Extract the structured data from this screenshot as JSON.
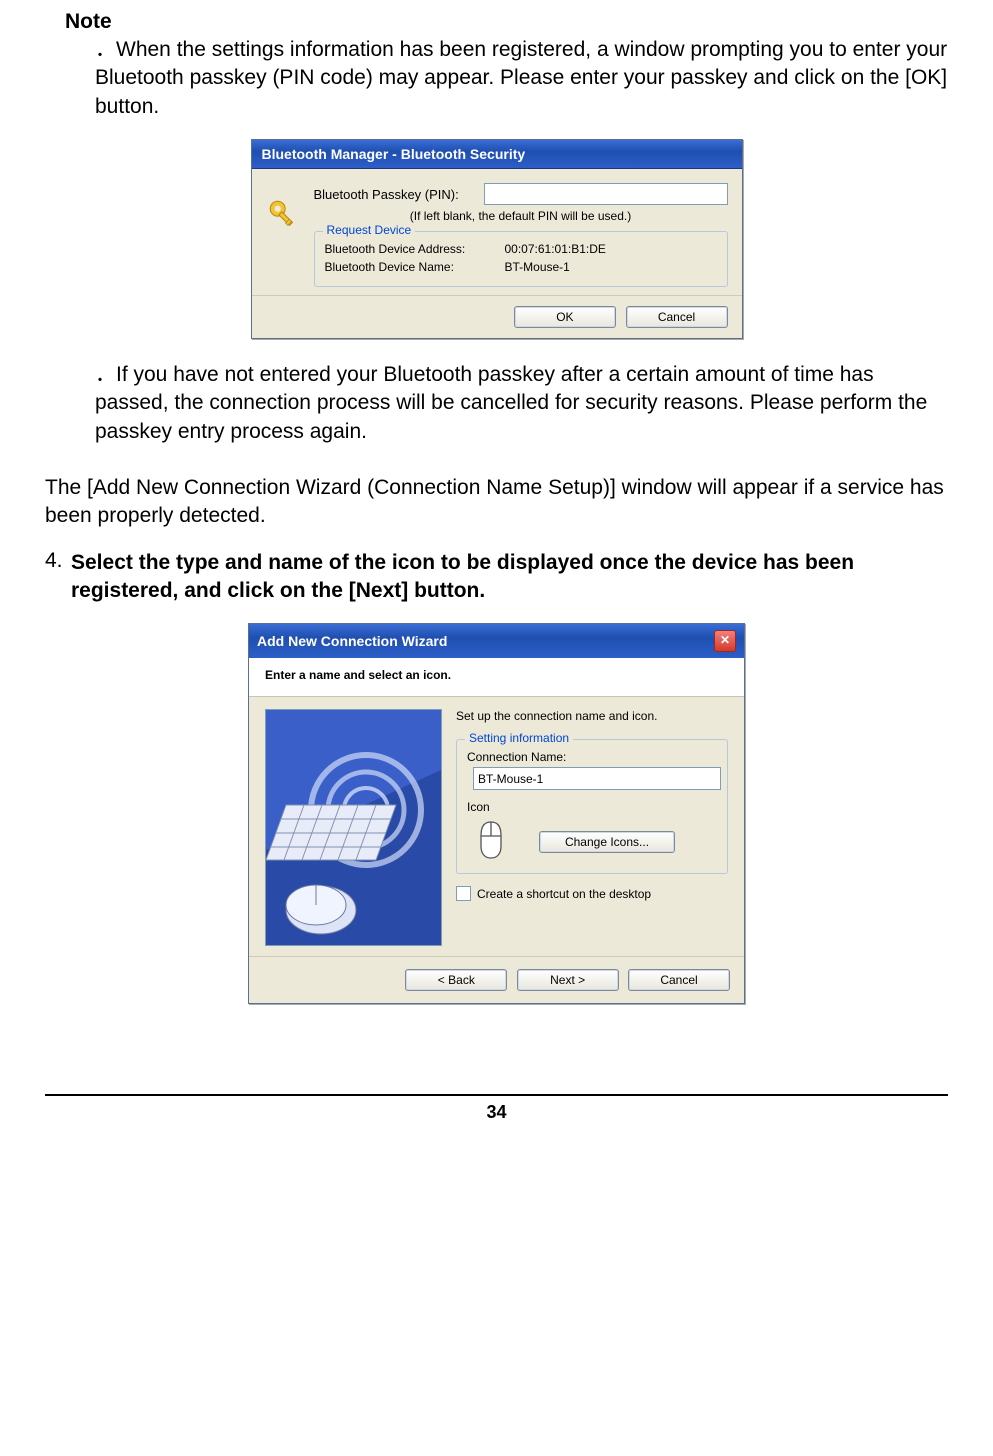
{
  "note": {
    "heading": "Note",
    "item1": "．When the settings information has been registered, a window prompting you to enter your Bluetooth passkey (PIN code) may appear. Please enter your passkey and click on the [OK] button.",
    "item2": "．If you have not entered your Bluetooth passkey after a certain amount of time has passed, the connection process will be cancelled for security reasons. Please perform the passkey entry process again."
  },
  "dialog1": {
    "title": "Bluetooth Manager - Bluetooth Security",
    "passkey_label": "Bluetooth Passkey (PIN):",
    "hint": "(If left blank, the default PIN will be used.)",
    "group_legend": "Request Device",
    "addr_label": "Bluetooth Device Address:",
    "addr_value": "00:07:61:01:B1:DE",
    "name_label": "Bluetooth Device Name:",
    "name_value": "BT-Mouse-1",
    "ok": "OK",
    "cancel": "Cancel"
  },
  "main_para": "The [Add New Connection Wizard (Connection Name Setup)] window will appear if a service has been properly detected.",
  "step4": {
    "num": "4.",
    "text": "Select the type and name of the icon to be displayed once the device has been registered, and click on the [Next] button."
  },
  "dialog2": {
    "title": "Add New Connection Wizard",
    "subhead": "Enter a name and select an icon.",
    "instr": "Set up the connection name and icon.",
    "group_legend": "Setting information",
    "conn_label": "Connection Name:",
    "conn_value": "BT-Mouse-1",
    "icon_label": "Icon",
    "change_btn": "Change Icons...",
    "shortcut": "Create a shortcut on the desktop",
    "back": "< Back",
    "next": "Next >",
    "cancel": "Cancel"
  },
  "page_number": "34"
}
